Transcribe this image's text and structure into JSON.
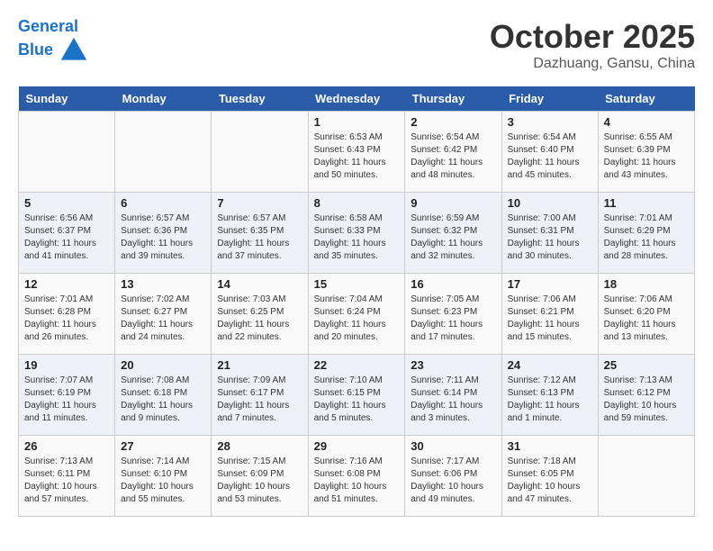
{
  "header": {
    "logo_line1": "General",
    "logo_line2": "Blue",
    "month_title": "October 2025",
    "subtitle": "Dazhuang, Gansu, China"
  },
  "days_of_week": [
    "Sunday",
    "Monday",
    "Tuesday",
    "Wednesday",
    "Thursday",
    "Friday",
    "Saturday"
  ],
  "weeks": [
    [
      {
        "day": "",
        "info": ""
      },
      {
        "day": "",
        "info": ""
      },
      {
        "day": "",
        "info": ""
      },
      {
        "day": "1",
        "info": "Sunrise: 6:53 AM\nSunset: 6:43 PM\nDaylight: 11 hours\nand 50 minutes."
      },
      {
        "day": "2",
        "info": "Sunrise: 6:54 AM\nSunset: 6:42 PM\nDaylight: 11 hours\nand 48 minutes."
      },
      {
        "day": "3",
        "info": "Sunrise: 6:54 AM\nSunset: 6:40 PM\nDaylight: 11 hours\nand 45 minutes."
      },
      {
        "day": "4",
        "info": "Sunrise: 6:55 AM\nSunset: 6:39 PM\nDaylight: 11 hours\nand 43 minutes."
      }
    ],
    [
      {
        "day": "5",
        "info": "Sunrise: 6:56 AM\nSunset: 6:37 PM\nDaylight: 11 hours\nand 41 minutes."
      },
      {
        "day": "6",
        "info": "Sunrise: 6:57 AM\nSunset: 6:36 PM\nDaylight: 11 hours\nand 39 minutes."
      },
      {
        "day": "7",
        "info": "Sunrise: 6:57 AM\nSunset: 6:35 PM\nDaylight: 11 hours\nand 37 minutes."
      },
      {
        "day": "8",
        "info": "Sunrise: 6:58 AM\nSunset: 6:33 PM\nDaylight: 11 hours\nand 35 minutes."
      },
      {
        "day": "9",
        "info": "Sunrise: 6:59 AM\nSunset: 6:32 PM\nDaylight: 11 hours\nand 32 minutes."
      },
      {
        "day": "10",
        "info": "Sunrise: 7:00 AM\nSunset: 6:31 PM\nDaylight: 11 hours\nand 30 minutes."
      },
      {
        "day": "11",
        "info": "Sunrise: 7:01 AM\nSunset: 6:29 PM\nDaylight: 11 hours\nand 28 minutes."
      }
    ],
    [
      {
        "day": "12",
        "info": "Sunrise: 7:01 AM\nSunset: 6:28 PM\nDaylight: 11 hours\nand 26 minutes."
      },
      {
        "day": "13",
        "info": "Sunrise: 7:02 AM\nSunset: 6:27 PM\nDaylight: 11 hours\nand 24 minutes."
      },
      {
        "day": "14",
        "info": "Sunrise: 7:03 AM\nSunset: 6:25 PM\nDaylight: 11 hours\nand 22 minutes."
      },
      {
        "day": "15",
        "info": "Sunrise: 7:04 AM\nSunset: 6:24 PM\nDaylight: 11 hours\nand 20 minutes."
      },
      {
        "day": "16",
        "info": "Sunrise: 7:05 AM\nSunset: 6:23 PM\nDaylight: 11 hours\nand 17 minutes."
      },
      {
        "day": "17",
        "info": "Sunrise: 7:06 AM\nSunset: 6:21 PM\nDaylight: 11 hours\nand 15 minutes."
      },
      {
        "day": "18",
        "info": "Sunrise: 7:06 AM\nSunset: 6:20 PM\nDaylight: 11 hours\nand 13 minutes."
      }
    ],
    [
      {
        "day": "19",
        "info": "Sunrise: 7:07 AM\nSunset: 6:19 PM\nDaylight: 11 hours\nand 11 minutes."
      },
      {
        "day": "20",
        "info": "Sunrise: 7:08 AM\nSunset: 6:18 PM\nDaylight: 11 hours\nand 9 minutes."
      },
      {
        "day": "21",
        "info": "Sunrise: 7:09 AM\nSunset: 6:17 PM\nDaylight: 11 hours\nand 7 minutes."
      },
      {
        "day": "22",
        "info": "Sunrise: 7:10 AM\nSunset: 6:15 PM\nDaylight: 11 hours\nand 5 minutes."
      },
      {
        "day": "23",
        "info": "Sunrise: 7:11 AM\nSunset: 6:14 PM\nDaylight: 11 hours\nand 3 minutes."
      },
      {
        "day": "24",
        "info": "Sunrise: 7:12 AM\nSunset: 6:13 PM\nDaylight: 11 hours\nand 1 minute."
      },
      {
        "day": "25",
        "info": "Sunrise: 7:13 AM\nSunset: 6:12 PM\nDaylight: 10 hours\nand 59 minutes."
      }
    ],
    [
      {
        "day": "26",
        "info": "Sunrise: 7:13 AM\nSunset: 6:11 PM\nDaylight: 10 hours\nand 57 minutes."
      },
      {
        "day": "27",
        "info": "Sunrise: 7:14 AM\nSunset: 6:10 PM\nDaylight: 10 hours\nand 55 minutes."
      },
      {
        "day": "28",
        "info": "Sunrise: 7:15 AM\nSunset: 6:09 PM\nDaylight: 10 hours\nand 53 minutes."
      },
      {
        "day": "29",
        "info": "Sunrise: 7:16 AM\nSunset: 6:08 PM\nDaylight: 10 hours\nand 51 minutes."
      },
      {
        "day": "30",
        "info": "Sunrise: 7:17 AM\nSunset: 6:06 PM\nDaylight: 10 hours\nand 49 minutes."
      },
      {
        "day": "31",
        "info": "Sunrise: 7:18 AM\nSunset: 6:05 PM\nDaylight: 10 hours\nand 47 minutes."
      },
      {
        "day": "",
        "info": ""
      }
    ]
  ]
}
